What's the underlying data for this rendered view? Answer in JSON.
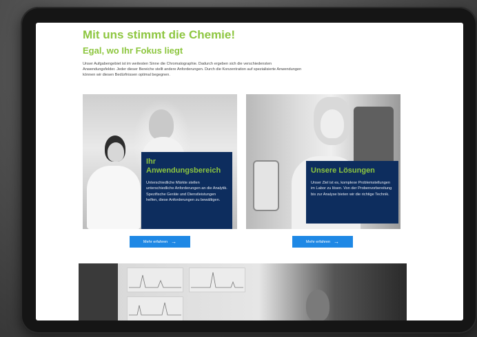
{
  "page": {
    "headline": "Mit uns stimmt die Chemie!",
    "subheadline": "Egal, wo Ihr Fokus liegt",
    "intro": "Unser Aufgabengebiet ist im weitesten Sinne die Chromatographie. Dadurch ergeben sich die verschiedensten Anwendungsfelder. Jeder dieser Bereiche stellt andere Anforderungen. Durch die Konzentration auf spezialisierte Anwendungen können wir diesen Bedürfnissen optimal begegnen."
  },
  "cards": [
    {
      "title": "Ihr Anwendungsbereich",
      "text": "Unterschiedliche Märkte stellen unterschiedliche Anforderungen an die Analytik. Spezifische Geräte und Dienstleistungen helfen, diese Anforderungen zu bewältigen.",
      "button_label": "Mehr erfahren"
    },
    {
      "title": "Unsere Lösungen",
      "text": "Unser Ziel ist es, komplexe Problemstellungen im Labor zu lösen. Von der Probenvorbereitung bis zur Analyse bieten wir die richtige Technik.",
      "button_label": "Mehr erfahren"
    }
  ],
  "colors": {
    "accent_green": "#8dc63f",
    "overlay_navy": "#0d2d5e",
    "button_blue": "#1e88e5"
  },
  "icons": {
    "button_arrow": "arrow-right-icon"
  }
}
